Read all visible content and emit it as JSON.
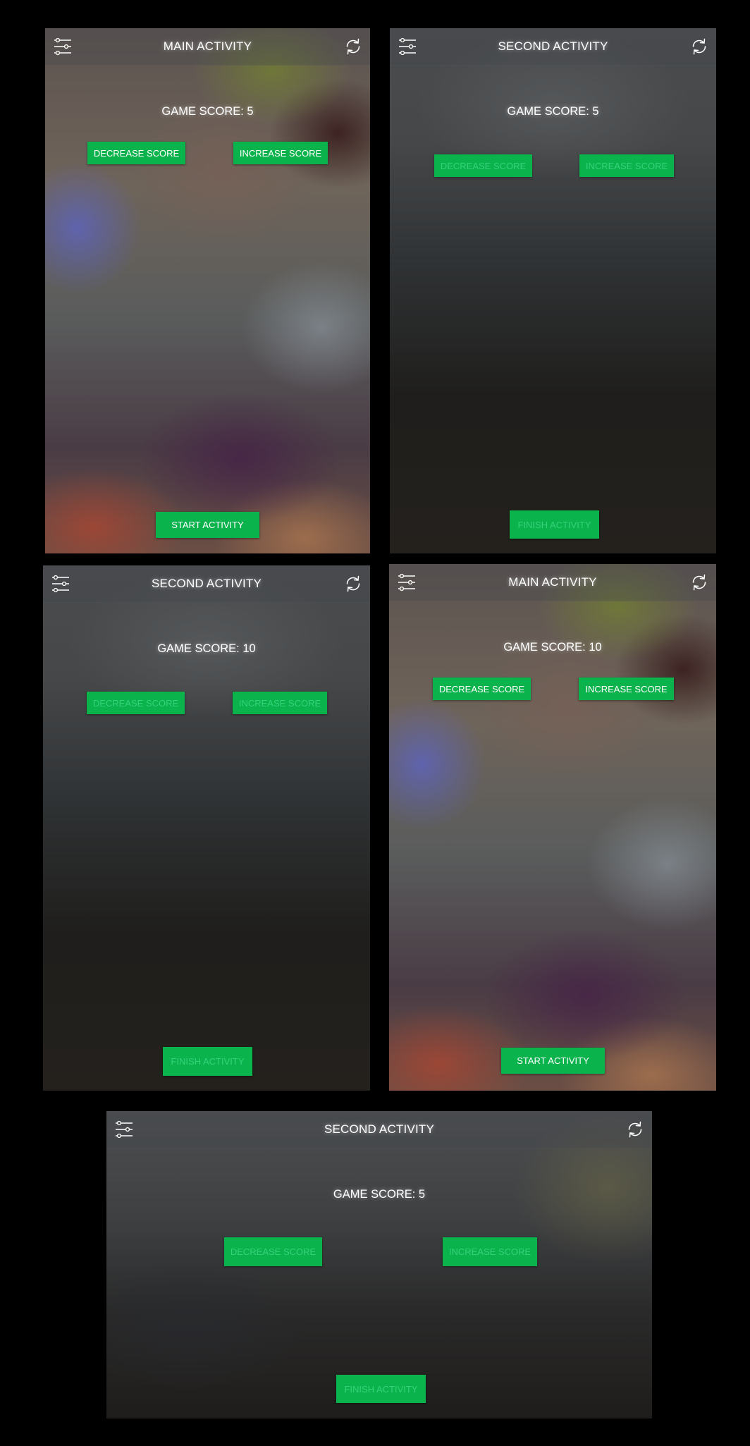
{
  "screens": [
    {
      "title": "MAIN ACTIVITY",
      "score_text": "GAME SCORE: 5",
      "decrease_label": "DECREASE SCORE",
      "increase_label": "INCREASE SCORE",
      "bottom_label": "START ACTIVITY",
      "score_buttons_enabled": true,
      "bottom_button_enabled": true
    },
    {
      "title": "SECOND ACTIVITY",
      "score_text": "GAME SCORE: 5",
      "decrease_label": "DECREASE SCORE",
      "increase_label": "INCREASE SCORE",
      "bottom_label": "FINISH ACTIVITY",
      "score_buttons_enabled": false,
      "bottom_button_enabled": false
    },
    {
      "title": "SECOND ACTIVITY",
      "score_text": "GAME SCORE: 10",
      "decrease_label": "DECREASE SCORE",
      "increase_label": "INCREASE SCORE",
      "bottom_label": "FINISH ACTIVITY",
      "score_buttons_enabled": false,
      "bottom_button_enabled": false
    },
    {
      "title": "MAIN ACTIVITY",
      "score_text": "GAME SCORE: 10",
      "decrease_label": "DECREASE SCORE",
      "increase_label": "INCREASE SCORE",
      "bottom_label": "START ACTIVITY",
      "score_buttons_enabled": true,
      "bottom_button_enabled": true
    },
    {
      "title": "SECOND ACTIVITY",
      "score_text": "GAME SCORE: 5",
      "decrease_label": "DECREASE SCORE",
      "increase_label": "INCREASE SCORE",
      "bottom_label": "FINISH ACTIVITY",
      "score_buttons_enabled": false,
      "bottom_button_enabled": false
    }
  ],
  "icons": {
    "left": "sliders-icon",
    "right": "refresh-icon"
  },
  "colors": {
    "button_green": "#0ab34c",
    "enabled_label": "#ffffff",
    "disabled_label": "#36d27a",
    "page_background": "#000000"
  }
}
